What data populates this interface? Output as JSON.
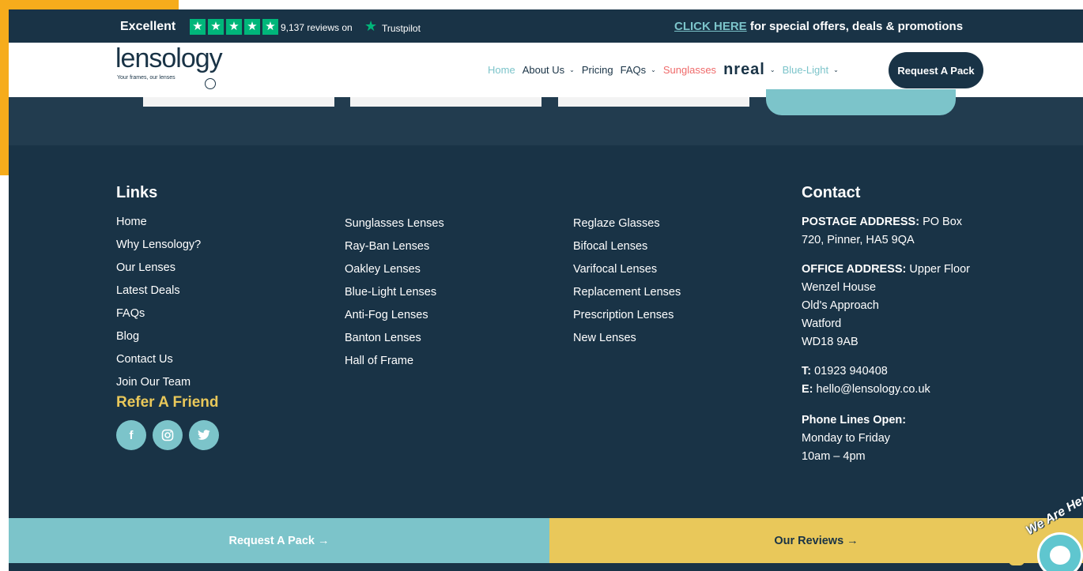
{
  "colors": {
    "navy": "#193346",
    "teal": "#7cc4ca",
    "yellow": "#e9c85a",
    "coral": "#ef6b6b",
    "trustpilot_green": "#00b67a",
    "frame_orange": "#f6ac1c"
  },
  "trustbar": {
    "rating_label": "Excellent",
    "stars": [
      "★",
      "★",
      "★",
      "★",
      "★"
    ],
    "reviews_text": "9,137 reviews on",
    "star_logo": "★",
    "brand": "Trustpilot",
    "promo_link": "CLICK HERE",
    "promo_text": " for special offers, deals & promotions"
  },
  "header": {
    "logo_word": "lensology",
    "logo_tagline": "Your frames, our lenses",
    "nav": {
      "home": "Home",
      "about": "About Us",
      "pricing": "Pricing",
      "faqs": "FAQs",
      "sunglasses": "Sunglasses",
      "nreal": "nreal",
      "bluelight": "Blue-Light",
      "chevron": "⌄"
    },
    "cta": "Request A Pack"
  },
  "footer": {
    "links_heading": "Links",
    "col1": [
      "Home",
      "Why Lensology?",
      "Our Lenses",
      "Latest Deals",
      "FAQs",
      "Blog",
      "Contact Us",
      "Join Our Team"
    ],
    "col2": [
      "Sunglasses Lenses",
      "Ray-Ban Lenses",
      "Oakley Lenses",
      "Blue-Light Lenses",
      "Anti-Fog Lenses",
      "Banton Lenses",
      "Hall of Frame"
    ],
    "col3": [
      "Reglaze Glasses",
      "Bifocal Lenses",
      "Varifocal Lenses",
      "Replacement Lenses",
      "Prescription Lenses",
      "New Lenses"
    ],
    "refer": "Refer A Friend",
    "social": {
      "facebook": "f",
      "instagram": "◎",
      "twitter": "🐦"
    },
    "contact": {
      "heading": "Contact",
      "postage_label": "POSTAGE ADDRESS:",
      "postage_line1": " PO Box",
      "postage_line2": "720, Pinner, HA5 9QA",
      "office_label": "OFFICE ADDRESS:",
      "office_line1": " Upper Floor",
      "office_line2": "Wenzel House",
      "office_line3": "Old's Approach",
      "office_line4": "Watford",
      "office_line5": "WD18 9AB",
      "phone_label": "T:",
      "phone": " 01923 940408",
      "email_label": "E:",
      "email": " hello@lensology.co.uk",
      "hours_label": "Phone Lines Open:",
      "hours_days": "Monday to Friday",
      "hours_time": "10am – 4pm"
    }
  },
  "cta_bar": {
    "request": "Request A Pack →",
    "reviews": "Our Reviews →"
  },
  "chat": {
    "label": "We Are Here!"
  }
}
